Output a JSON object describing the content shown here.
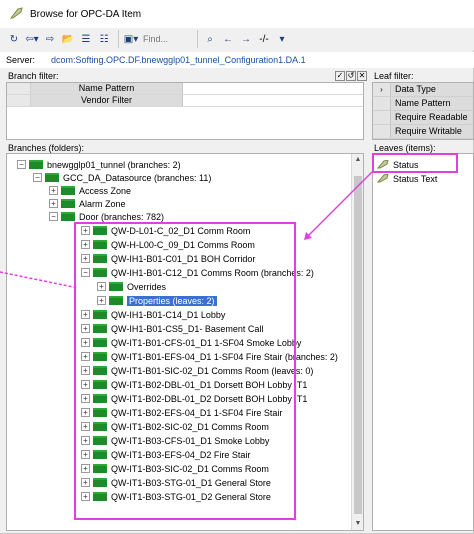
{
  "window": {
    "title": "Browse for OPC-DA Item"
  },
  "toolbar": {
    "find_placeholder": "Find...",
    "zoom_label": "-/-"
  },
  "server": {
    "label": "Server:",
    "value": "dcom:Softing.OPC.DF.bnewgglp01_tunnel_Configuration1.DA.1"
  },
  "branch_filter": {
    "label": "Branch filter:",
    "rows": [
      "Name Pattern",
      "Vendor Filter"
    ]
  },
  "leaf_filter": {
    "label": "Leaf filter:",
    "rows": [
      "Data Type",
      "Name Pattern",
      "Require Readable",
      "Require Writable"
    ]
  },
  "branches": {
    "label": "Branches (folders):",
    "items": [
      "bnewgglp01_tunnel (branches: 2)",
      "GCC_DA_Datasource (branches: 11)",
      "Access Zone",
      "Alarm Zone",
      "Door (branches: 782)",
      "QW-D-L01-C_02_D1 Comm Room",
      "QW-H-L00-C_09_D1 Comms Room",
      "QW-IH1-B01-C01_D1 BOH Corridor",
      "QW-IH1-B01-C12_D1 Comms Room (branches: 2)",
      "Overrides",
      "Properties (leaves: 2)",
      "QW-IH1-B01-C14_D1 Lobby",
      "QW-IH1-B01-CS5_D1- Basement Call",
      "QW-IT1-B01-CFS-01_D1 1-SF04 Smoke Lobby",
      "QW-IT1-B01-EFS-04_D1 1-SF04 Fire Stair (branches: 2)",
      "QW-IT1-B01-SIC-02_D1 Comms Room (leaves: 0)",
      "QW-IT1-B02-DBL-01_D1 Dorsett BOH Lobby IT1",
      "QW-IT1-B02-DBL-01_D2 Dorsett BOH Lobby IT1",
      "QW-IT1-B02-EFS-04_D1 1-SF04 Fire Stair",
      "QW-IT1-B02-SIC-02_D1 Comms Room",
      "QW-IT1-B03-CFS-01_D1 Smoke Lobby",
      "QW-IT1-B03-EFS-04_D2 Fire Stair",
      "QW-IT1-B03-SIC-02_D1 Comms Room",
      "QW-IT1-B03-STG-01_D1 General Store",
      "QW-IT1-B03-STG-01_D2 General Store"
    ]
  },
  "leaves": {
    "label": "Leaves (items):",
    "items": [
      "Status",
      "Status Text"
    ]
  },
  "colors": {
    "highlight": "#e040e0",
    "folder": "#1f8a2a",
    "selection": "#3b6fd0"
  }
}
